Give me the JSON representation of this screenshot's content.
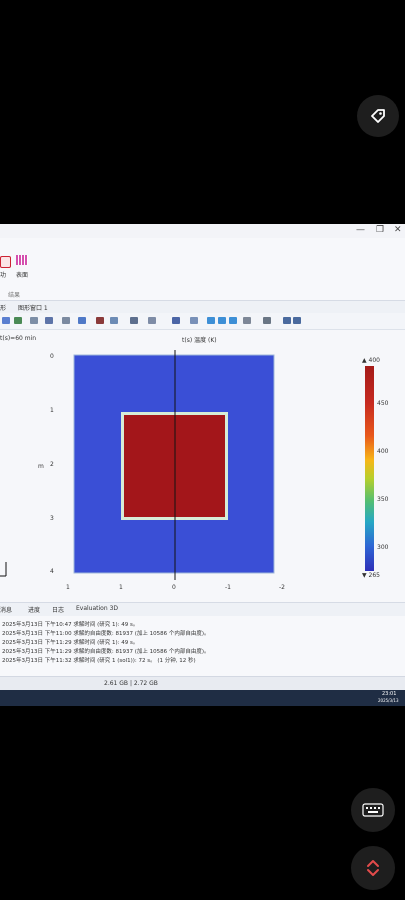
{
  "overlay": {
    "tag_icon": "tag-icon",
    "keyboard_icon": "keyboard-icon",
    "expand_icon": "expand-icon"
  },
  "window": {
    "minimize": "—",
    "restore": "❐",
    "close": "✕"
  },
  "ribbon": {
    "btn1_label": "功",
    "btn2_label": "表面",
    "group_label": "结果"
  },
  "tabs": {
    "left": "形",
    "graphics_tab": "图形窗口 1"
  },
  "plot": {
    "time_label": "t(s)=60 min",
    "title": "t(s) 温度 (K)",
    "y_ticks": [
      "0",
      "1",
      "2",
      "3",
      "4"
    ],
    "y_axis_label": "m",
    "x_ticks": [
      "1",
      "1",
      "0",
      "-1",
      "-2"
    ],
    "colors": {
      "outer": "#3a4fd6",
      "inner": "#a3161a",
      "border": "#d7ecd7"
    }
  },
  "colorbar": {
    "max": "▲ 400",
    "min": "▼ 265",
    "ticks": [
      "450",
      "400",
      "350",
      "300"
    ]
  },
  "lower_tabs": {
    "t1": "消息",
    "t2": "进度",
    "t3": "日志",
    "t4": "Evaluation 3D"
  },
  "messages": [
    "2025年3月13日 下午10:47 求解时间 (研究 1): 49 s。",
    "2025年3月13日 下午11:00 求解的自由度数: 81937 (加上 10586 个内部自由度)。",
    "2025年3月13日 下午11:29 求解时间 (研究 1): 49 s。",
    "2025年3月13日 下午11:29 求解的自由度数: 81937 (加上 10586 个内部自由度)。",
    "2025年3月13日 下午11:32 求解时间 (研究 1 (sol1)): 72 s。 (1 分钟, 12 秒)"
  ],
  "status": {
    "memory": "2.61 GB | 2.72 GB"
  },
  "taskbar": {
    "time": "23:01",
    "date": "2025/3/13"
  }
}
